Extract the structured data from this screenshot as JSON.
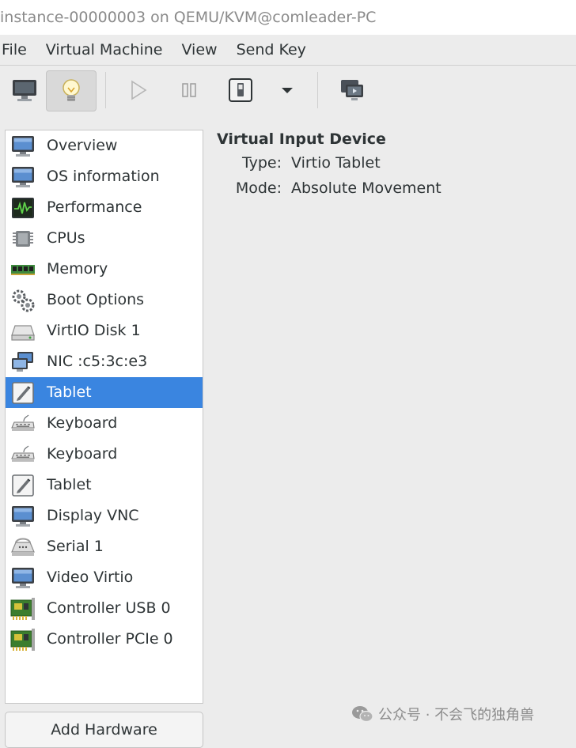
{
  "window": {
    "title": "instance-00000003 on QEMU/KVM@comleader-PC"
  },
  "menu": [
    "File",
    "Virtual Machine",
    "View",
    "Send Key"
  ],
  "toolbar": {
    "buttons": [
      "console-view-button",
      "details-view-button",
      "run-button",
      "pause-button",
      "shutdown-button",
      "shutdown-menu-button",
      "fullscreen-button"
    ]
  },
  "sidebar": {
    "items": [
      {
        "label": "Overview",
        "icon": "monitor-icon"
      },
      {
        "label": "OS information",
        "icon": "monitor-icon"
      },
      {
        "label": "Performance",
        "icon": "performance-graph-icon"
      },
      {
        "label": "CPUs",
        "icon": "cpu-chip-icon"
      },
      {
        "label": "Memory",
        "icon": "memory-module-icon"
      },
      {
        "label": "Boot Options",
        "icon": "gears-icon"
      },
      {
        "label": "VirtIO Disk 1",
        "icon": "disk-drive-icon"
      },
      {
        "label": "NIC :c5:3c:e3",
        "icon": "network-icon"
      },
      {
        "label": "Tablet",
        "icon": "tablet-icon",
        "selected": true
      },
      {
        "label": "Keyboard",
        "icon": "keyboard-icon"
      },
      {
        "label": "Keyboard",
        "icon": "keyboard-icon"
      },
      {
        "label": "Tablet",
        "icon": "tablet-icon"
      },
      {
        "label": "Display VNC",
        "icon": "monitor-icon"
      },
      {
        "label": "Serial 1",
        "icon": "serial-port-icon"
      },
      {
        "label": "Video Virtio",
        "icon": "monitor-icon"
      },
      {
        "label": "Controller USB 0",
        "icon": "controller-card-icon"
      },
      {
        "label": "Controller PCIe 0",
        "icon": "controller-card-icon"
      }
    ],
    "add_button": "Add Hardware"
  },
  "details": {
    "title": "Virtual Input Device",
    "type_label": "Type:",
    "type_value": "Virtio Tablet",
    "mode_label": "Mode:",
    "mode_value": "Absolute Movement"
  },
  "watermark": {
    "text": "公众号 · 不会飞的独角兽"
  },
  "colors": {
    "selection": "#3a85e0",
    "background": "#ececec"
  }
}
